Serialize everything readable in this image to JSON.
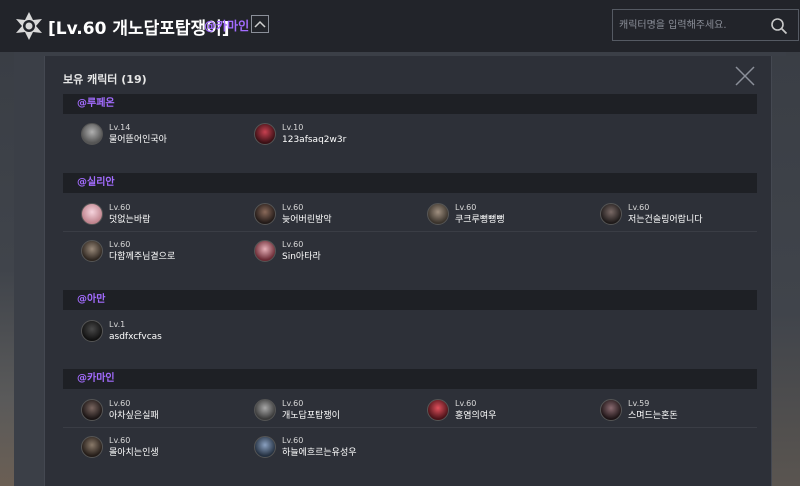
{
  "header": {
    "title": "[Lv.60 개노답포탑쟁이]",
    "server": "@카마인",
    "search_placeholder": "캐릭터명을 입력해주세요."
  },
  "modal": {
    "title": "보유 캐릭터 (19)"
  },
  "sections": [
    {
      "server": "@루페온",
      "characters": [
        {
          "level": "Lv.14",
          "name": "물어뜯어인국아",
          "avatar_color": "#8a8a8a"
        },
        {
          "level": "Lv.10",
          "name": "123afsaq2w3r",
          "avatar_color": "#9b2b35"
        }
      ]
    },
    {
      "server": "@실리안",
      "characters": [
        {
          "level": "Lv.60",
          "name": "덧없는바람",
          "avatar_color": "#e8b9c8"
        },
        {
          "level": "Lv.60",
          "name": "늦어버린밤악",
          "avatar_color": "#4a3a36"
        },
        {
          "level": "Lv.60",
          "name": "쿠크루뻥뻥뻥",
          "avatar_color": "#6d6459"
        },
        {
          "level": "Lv.60",
          "name": "저는건슬링어랍니다",
          "avatar_color": "#3c3433"
        },
        {
          "level": "Lv.60",
          "name": "다함께주님곁으로",
          "avatar_color": "#5a4e44"
        },
        {
          "level": "Lv.60",
          "name": "Sin아타라",
          "avatar_color": "#c27a84"
        }
      ]
    },
    {
      "server": "@아만",
      "characters": [
        {
          "level": "Lv.1",
          "name": "asdfxcfvcas",
          "avatar_color": "#222222"
        }
      ]
    },
    {
      "server": "@카마인",
      "characters": [
        {
          "level": "Lv.60",
          "name": "아차싶은실패",
          "avatar_color": "#3a2f2c"
        },
        {
          "level": "Lv.60",
          "name": "개노답포탑쟁이",
          "avatar_color": "#6a6a6a"
        },
        {
          "level": "Lv.60",
          "name": "홍염의여우",
          "avatar_color": "#a8323c"
        },
        {
          "level": "Lv.59",
          "name": "스며드는혼돈",
          "avatar_color": "#3a2a2e"
        },
        {
          "level": "Lv.60",
          "name": "몰아치는인생",
          "avatar_color": "#4a3d36"
        },
        {
          "level": "Lv.60",
          "name": "하늘에흐르는유성우",
          "avatar_color": "#4a5a72"
        }
      ]
    }
  ],
  "colors": {
    "accent": "#a36cff",
    "panel": "#2d3038",
    "section_bar": "#1e2025"
  }
}
